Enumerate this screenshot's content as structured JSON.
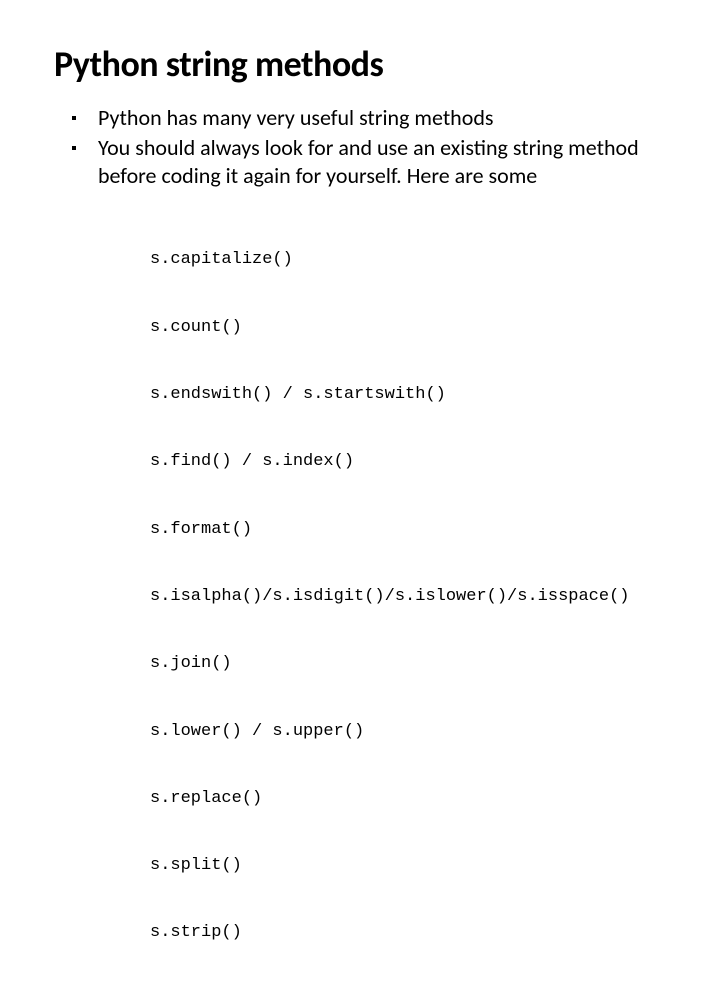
{
  "title": "Python string methods",
  "bullets": [
    "Python has many very useful string methods",
    "You should always look for and use an existing string method before coding it again for yourself.  Here are some"
  ],
  "code_lines": [
    "s.capitalize()",
    "s.count()",
    "s.endswith() / s.startswith()",
    "s.find() / s.index()",
    "s.format()",
    "s.isalpha()/s.isdigit()/s.islower()/s.isspace()",
    "s.join()",
    "s.lower() / s.upper()",
    "s.replace()",
    "s.split()",
    "s.strip()"
  ]
}
